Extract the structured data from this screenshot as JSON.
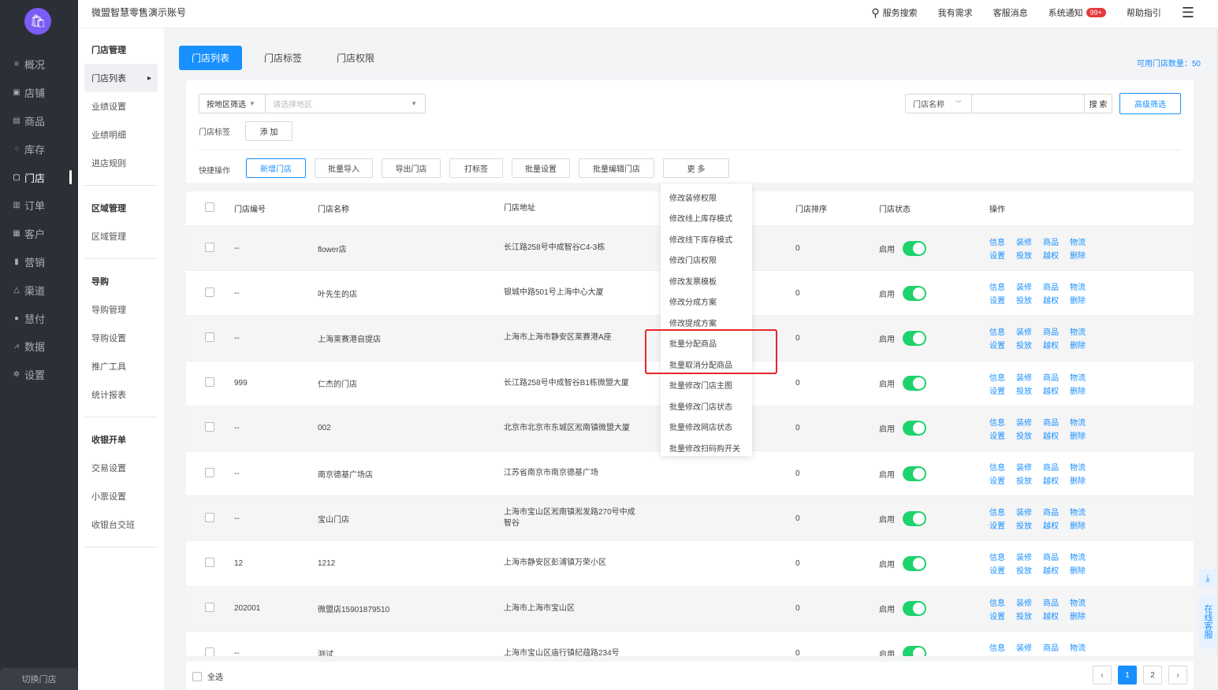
{
  "header": {
    "title": "微盟智慧零售演示账号",
    "search": "服务搜索",
    "needs": "我有需求",
    "service_msg": "客服消息",
    "sys_notice": "系统通知",
    "notice_badge": "99+",
    "help": "帮助指引"
  },
  "nav": [
    {
      "label": "概况",
      "icon": "≡"
    },
    {
      "label": "店铺",
      "icon": "▣"
    },
    {
      "label": "商品",
      "icon": "▤"
    },
    {
      "label": "库存",
      "icon": "⁘"
    },
    {
      "label": "门店",
      "icon": "▢"
    },
    {
      "label": "订单",
      "icon": "▥"
    },
    {
      "label": "客户",
      "icon": "▦"
    },
    {
      "label": "营销",
      "icon": "▮"
    },
    {
      "label": "渠道",
      "icon": "△"
    },
    {
      "label": "慧付",
      "icon": "●"
    },
    {
      "label": "数据",
      "icon": "⩘"
    },
    {
      "label": "设置",
      "icon": "✲"
    }
  ],
  "switch_store": "切换门店",
  "subnav": {
    "g1_title": "门店管理",
    "g1_items": [
      "门店列表",
      "业绩设置",
      "业绩明细",
      "进店规则"
    ],
    "g2_title": "区域管理",
    "g2_items": [
      "区域管理"
    ],
    "g3_title": "导购",
    "g3_items": [
      "导购管理",
      "导购设置",
      "推广工具",
      "统计报表"
    ],
    "g4_title": "收银开单",
    "g4_items": [
      "交易设置",
      "小票设置",
      "收银台交班"
    ]
  },
  "tabs": [
    "门店列表",
    "门店标签",
    "门店权限"
  ],
  "store_count": "可用门店数量：50",
  "filter": {
    "region_label": "按地区筛选",
    "region_placeholder": "请选择地区",
    "tag_label": "门店标签",
    "tag_add": "添 加",
    "search_field": "门店名称",
    "search_btn": "搜 索",
    "advanced": "高级筛选",
    "quick_label": "快捷操作",
    "quick_btns": [
      "新增门店",
      "批量导入",
      "导出门店",
      "打标签",
      "批量设置",
      "批量编辑门店",
      "更 多"
    ]
  },
  "table": {
    "headers": [
      "门店编号",
      "门店名称",
      "门店地址",
      "门店排序",
      "门店状态",
      "操作"
    ],
    "ops_top": [
      "信息",
      "装修",
      "商品",
      "物流"
    ],
    "ops_bottom": [
      "设置",
      "投放",
      "越权",
      "删除"
    ],
    "rows": [
      {
        "no": "--",
        "name": "flower店",
        "addr": "长江路258号中成智谷C4-3栋",
        "sort": "0",
        "status": "启用"
      },
      {
        "no": "--",
        "name": "叶先生的店",
        "addr": "银城中路501号上海中心大厦",
        "sort": "0",
        "status": "启用"
      },
      {
        "no": "--",
        "name": "上海莱赛港自提店",
        "addr": "上海市上海市静安区莱赛港A座",
        "sort": "0",
        "status": "启用"
      },
      {
        "no": "999",
        "name": "仁杰的门店",
        "addr": "长江路258号中成智谷B1栋微盟大厦",
        "sort": "0",
        "status": "启用"
      },
      {
        "no": "--",
        "name": "002",
        "addr": "北京市北京市东城区淞南镇微盟大厦",
        "sort": "0",
        "status": "启用"
      },
      {
        "no": "--",
        "name": "南京德基广场店",
        "addr": "江苏省南京市南京德基广场",
        "sort": "0",
        "status": "启用"
      },
      {
        "no": "--",
        "name": "宝山门店",
        "addr": "上海市宝山区淞南镇淞发路270号中成智谷",
        "sort": "0",
        "status": "启用"
      },
      {
        "no": "12",
        "name": "1212",
        "addr": "上海市静安区彭浦镇万荣小区",
        "sort": "0",
        "status": "启用"
      },
      {
        "no": "202001",
        "name": "微盟店15901879510",
        "addr": "上海市上海市宝山区",
        "sort": "0",
        "status": "启用"
      },
      {
        "no": "--",
        "name": "测试",
        "addr": "上海市宝山区庙行镇纪蕴路234号",
        "sort": "0",
        "status": "启用"
      }
    ]
  },
  "dropdown": [
    "修改装修权限",
    "修改线上库存模式",
    "修改线下库存模式",
    "修改门店权限",
    "修改发票模板",
    "修改分成方案",
    "修改提成方案",
    "批量分配商品",
    "批量取消分配商品",
    "批量修改门店主图",
    "批量修改门店状态",
    "批量修改网店状态",
    "批量修改扫码购开关"
  ],
  "footer": {
    "select_all": "全选",
    "pages": [
      "1",
      "2"
    ]
  },
  "float_cs": "在线客服"
}
